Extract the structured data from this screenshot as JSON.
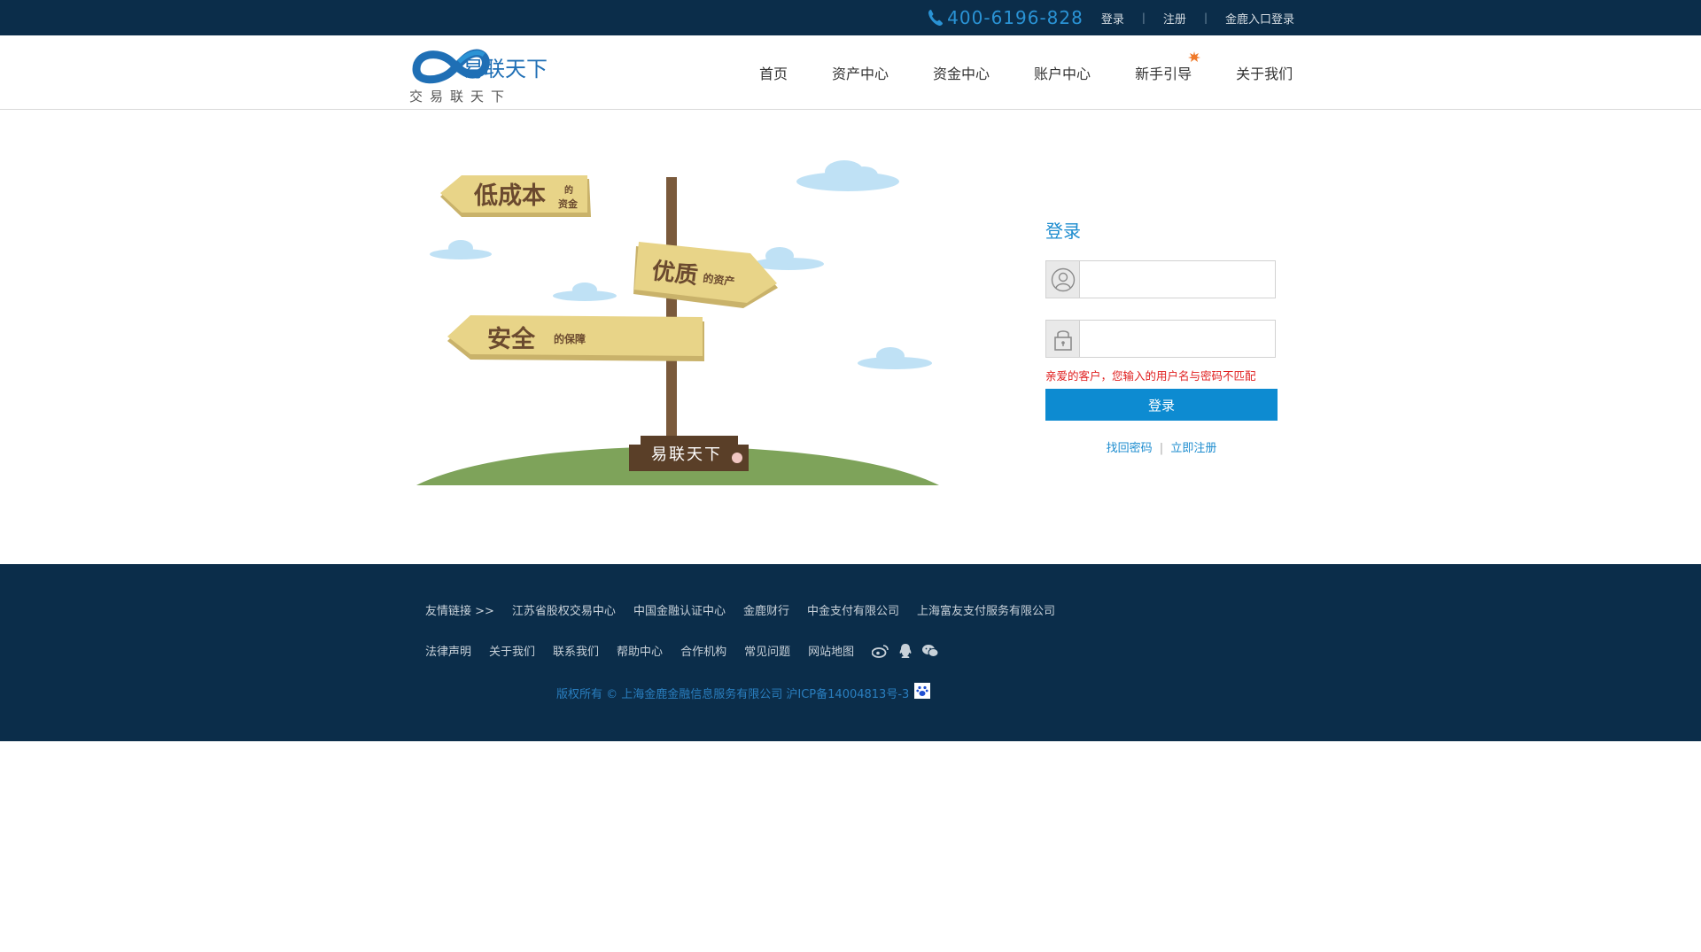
{
  "topbar": {
    "phone": "400-6196-828",
    "links": [
      "登录",
      "注册",
      "金鹿入口登录"
    ],
    "separator": "|"
  },
  "logo": {
    "brand": "易联天下",
    "slogan": "交易联天下",
    "icon": "infinity-logo-icon"
  },
  "nav": {
    "items": [
      "首页",
      "资产中心",
      "资金中心",
      "账户中心",
      "新手引导",
      "关于我们"
    ],
    "new_badge_icon": "maple-leaf-icon"
  },
  "illustration": {
    "sign1_big": "低成本",
    "sign1_small_top": "的",
    "sign1_small_bottom": "资金",
    "sign2_big": "优质",
    "sign2_small": "的资产",
    "sign3_big": "安全",
    "sign3_small": "的保障",
    "base_label": "易联天下"
  },
  "login": {
    "title": "登录",
    "username_placeholder": "",
    "password_placeholder": "",
    "username_icon": "user-icon",
    "password_icon": "lock-icon",
    "error": "亲爱的客户，您输入的用户名与密码不匹配",
    "button": "登录",
    "forgot": "找回密码",
    "link_sep": "|",
    "register": "立即注册"
  },
  "footer": {
    "friend_label": "友情链接 >>",
    "friend_links": [
      "江苏省股权交易中心",
      "中国金融认证中心",
      "金鹿财行",
      "中金支付有限公司",
      "上海富友支付服务有限公司"
    ],
    "bottom_links": [
      "法律声明",
      "关于我们",
      "联系我们",
      "帮助中心",
      "合作机构",
      "常见问题",
      "网站地图"
    ],
    "social_icons": [
      "weibo-icon",
      "qq-icon",
      "wechat-icon"
    ],
    "copyright": "版权所有 © 上海金鹿金融信息服务有限公司 沪ICP备14004813号-3",
    "badge_icon": "paw-icon"
  },
  "colors": {
    "dark_navy": "#0b2d4a",
    "accent_blue": "#0d8bd1",
    "error_red": "#e02020",
    "sign_yellow": "#e8d488",
    "ground_green": "#7ea35a"
  }
}
